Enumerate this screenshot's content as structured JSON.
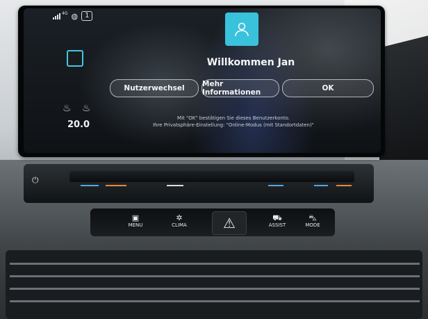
{
  "statusbar": {
    "signal_label": "4G",
    "profile_count": "1"
  },
  "sidebar": {
    "temperature": "20.0"
  },
  "welcome": {
    "title": "Willkommen Jan",
    "buttons": {
      "switch_user": "Nutzerwechsel",
      "more_info": "Mehr Informationen",
      "ok": "OK"
    },
    "info_line1": "Mit \"OK\" bestätigen Sie dieses Benutzerkonto.",
    "info_line2": "Ihre Privatsphäre-Einstellung: \"Online-Modus (mit Standortdaten)\""
  },
  "hardkeys": {
    "menu": "MENU",
    "clima": "CLIMA",
    "assist": "ASSIST",
    "mode": "MODE"
  },
  "icons": [
    "signal-icon",
    "steering-heat-icon",
    "profile-square-icon",
    "seat-heat-icon",
    "avatar-icon",
    "power-icon",
    "menu-icon",
    "clima-icon",
    "hazard-icon",
    "assist-icon",
    "mode-icon"
  ],
  "colors": {
    "accent_cyan": "#39c2dc",
    "slider_blue": "#4fa7e6",
    "slider_orange": "#e8893a"
  }
}
